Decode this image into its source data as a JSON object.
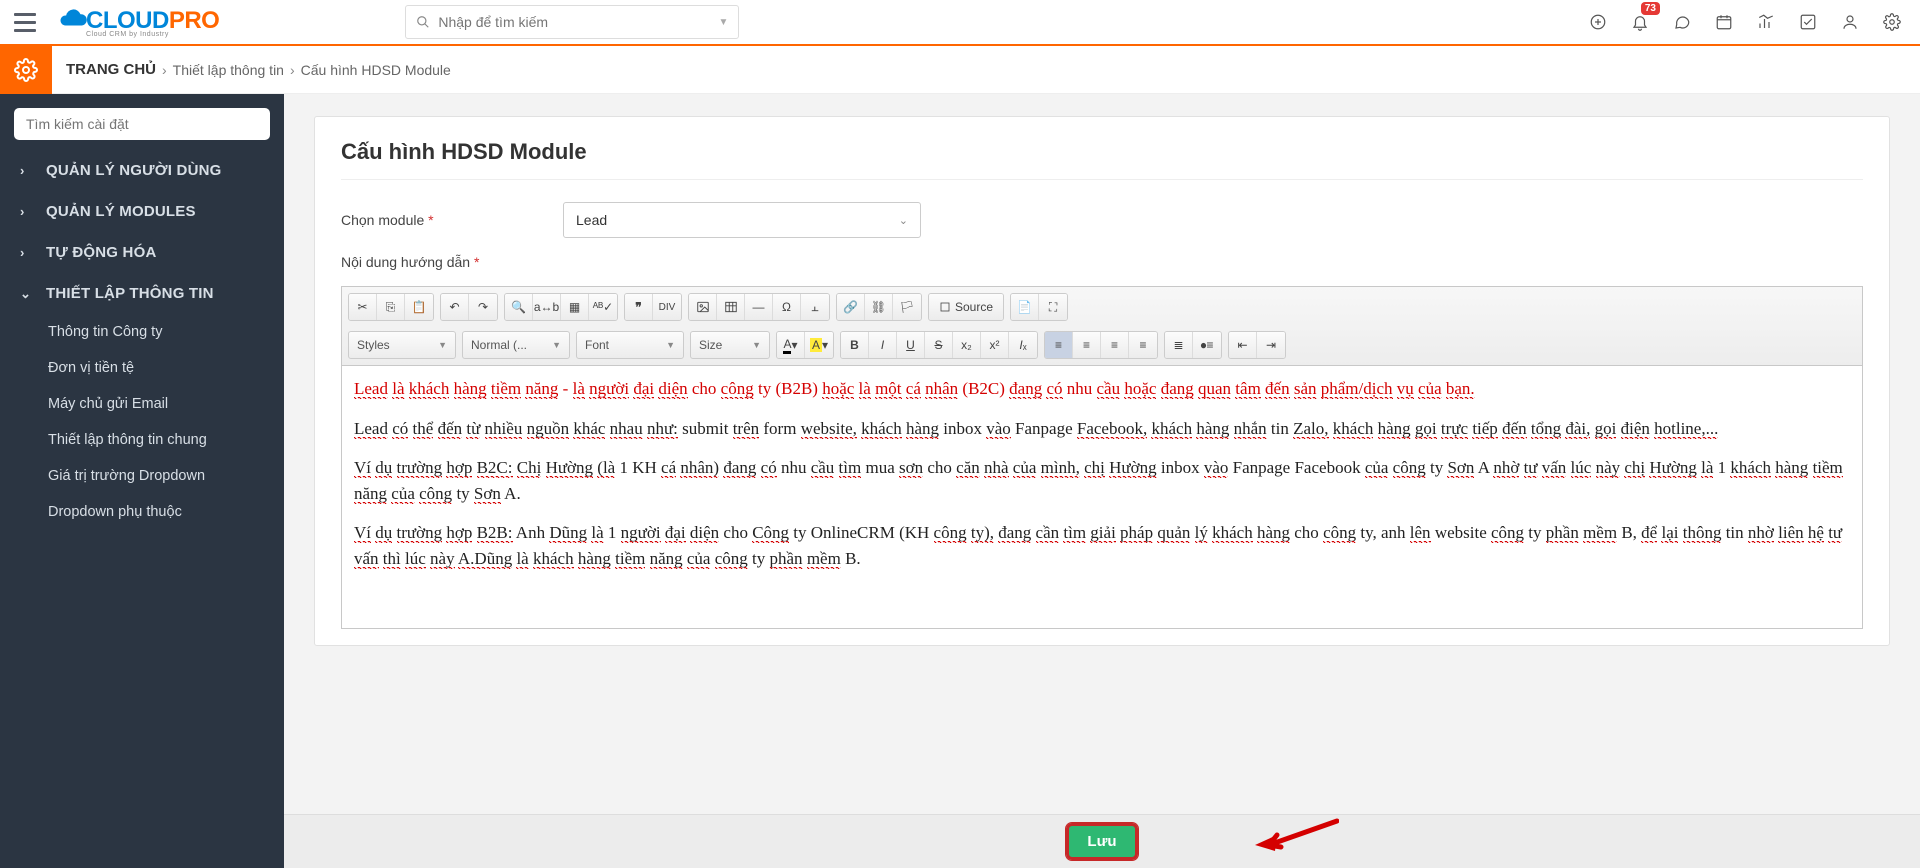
{
  "topbar": {
    "logo": {
      "brand_a": "CLOUD",
      "brand_b": "PRO",
      "tagline": "Cloud CRM by Industry"
    },
    "search_placeholder": "Nhập để tìm kiếm",
    "badge_count": "73"
  },
  "breadcrumb": {
    "home": "TRANG CHỦ",
    "level1": "Thiết lập thông tin",
    "level2": "Cấu hình HDSD Module"
  },
  "sidebar": {
    "search_placeholder": "Tìm kiếm cài đặt",
    "sections": [
      {
        "label": "QUẢN LÝ NGƯỜI DÙNG",
        "open": false
      },
      {
        "label": "QUẢN LÝ MODULES",
        "open": false
      },
      {
        "label": "TỰ ĐỘNG HÓA",
        "open": false
      },
      {
        "label": "THIẾT LẬP THÔNG TIN",
        "open": true
      }
    ],
    "subs": [
      "Thông tin Công ty",
      "Đơn vị tiền tệ",
      "Máy chủ gửi Email",
      "Thiết lập thông tin chung",
      "Giá trị trường Dropdown",
      "Dropdown phụ thuộc"
    ]
  },
  "page": {
    "title": "Cấu hình HDSD Module",
    "module_label": "Chọn module",
    "module_value": "Lead",
    "content_label": "Nội dung hướng dẫn",
    "save_label": "Lưu"
  },
  "toolbar": {
    "styles": "Styles",
    "format": "Normal (...",
    "font": "Font",
    "size": "Size",
    "source": "Source"
  },
  "editor_paragraphs": [
    {
      "style": "red",
      "text": "Lead là khách hàng tiềm năng - là người đại diện cho công ty (B2B) hoặc là một cá nhân (B2C) đang có nhu cầu hoặc đang quan tâm đến sản phẩm/dịch vụ của bạn."
    },
    {
      "style": "",
      "text": "Lead có thể đến từ nhiều nguồn khác nhau như: submit trên form website, khách hàng inbox vào Fanpage Facebook, khách hàng nhắn tin Zalo, khách hàng gọi trực tiếp đến tổng đài, gọi điện hotline,..."
    },
    {
      "style": "",
      "text": "Ví dụ trường hợp B2C:  Chị Hường (là 1 KH cá nhân) đang có nhu cầu tìm mua sơn cho căn nhà của mình, chị Hường inbox vào Fanpage Facebook của công ty Sơn A nhờ tư vấn lúc này chị Hường là 1 khách hàng tiềm năng của công ty Sơn A."
    },
    {
      "style": "",
      "text": "Ví dụ trường hợp B2B: Anh Dũng là 1 người đại diện cho Công ty OnlineCRM (KH công ty), đang cần tìm giải pháp quản lý khách hàng cho công ty, anh lên website công ty phần mềm B, để lại thông tin nhờ liên hệ tư vấn thì lúc này A.Dũng là khách hàng tiềm năng của công ty phần mềm B."
    }
  ]
}
